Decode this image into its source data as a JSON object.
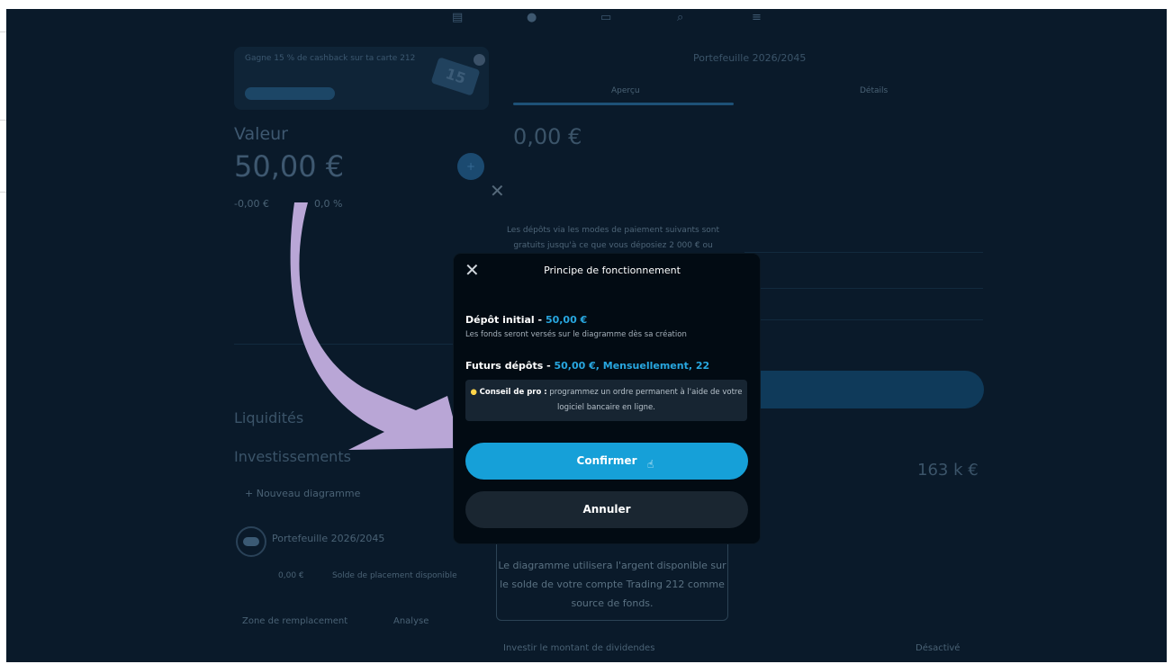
{
  "background": {
    "nav_icons": [
      "chart-icon",
      "globe-icon",
      "card-icon",
      "search-icon",
      "menu-icon"
    ],
    "promo": {
      "text": "Gagne 15 % de cashback sur ta carte 212",
      "pill": "",
      "card_text": "15"
    },
    "left": {
      "value_label": "Valeur",
      "value_amount": "50,00 €",
      "stats_1": "-0,00 €",
      "stats_2": "0,0 %",
      "liquidites": "Liquidités",
      "investissements": "Investissements",
      "new_pie": "+ Nouveau diagramme",
      "portfolio_name": "Portefeuille 2026/2045",
      "sub_1": "0,00 €",
      "sub_2": "Solde de placement disponible",
      "footer_1": "Zone de remplacement",
      "footer_2": "Analyse"
    },
    "right": {
      "title": "Portefeuille 2026/2045",
      "tab_active": "Aperçu",
      "tab_other": "Détails",
      "amount": "0,00 €",
      "deposit_text": "Les dépôts via les modes de paiement suivants sont gratuits jusqu'à ce que vous déposiez 2 000 € ou",
      "big_value": "163 k €",
      "info_box": "Le diagramme utilisera l'argent disponible sur le solde de votre compte Trading 212 comme source de fonds.",
      "bottom_left": "Investir le montant de dividendes",
      "bottom_right": "Désactivé"
    }
  },
  "modal": {
    "title": "Principe de fonctionnement",
    "initial_deposit_label": "Dépôt initial - ",
    "initial_deposit_value": "50,00 €",
    "initial_deposit_desc": "Les fonds seront versés sur le diagramme dès sa création",
    "future_deposits_label": "Futurs dépôts - ",
    "future_deposits_value": "50,00 €, Mensuellement, 22",
    "tip_label": "Conseil de pro :",
    "tip_text": " programmez un ordre permanent à l'aide de votre logiciel bancaire en ligne.",
    "confirm_label": "Confirmer",
    "cancel_label": "Annuler"
  },
  "colors": {
    "accent": "#16a0d8",
    "modal_bg": "#020b13",
    "overlay_bg": "#0a1a2a",
    "annotation_arrow": "#b9a6d6"
  }
}
